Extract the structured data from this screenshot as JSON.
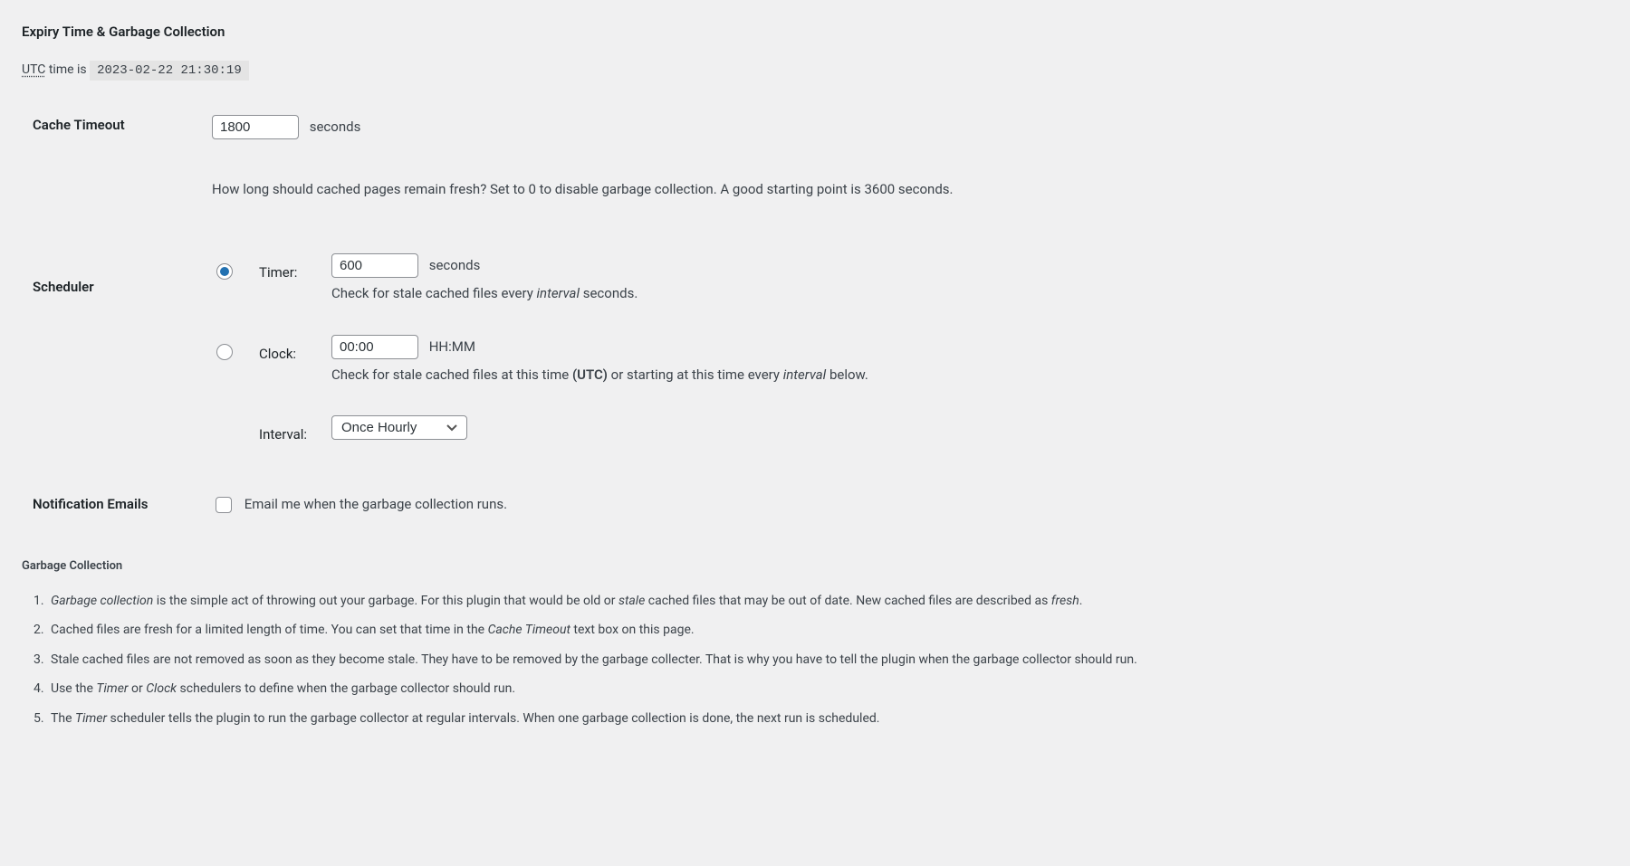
{
  "heading": "Expiry Time & Garbage Collection",
  "utc": {
    "abbr": "UTC",
    "label": " time is ",
    "value": "2023-02-22 21:30:19"
  },
  "cache_timeout": {
    "label": "Cache Timeout",
    "value": "1800",
    "unit": "seconds",
    "description": "How long should cached pages remain fresh? Set to 0 to disable garbage collection. A good starting point is 3600 seconds."
  },
  "scheduler": {
    "label": "Scheduler",
    "timer": {
      "label": "Timer:",
      "value": "600",
      "unit": "seconds",
      "help_pre": "Check for stale cached files every ",
      "help_em": "interval",
      "help_post": " seconds.",
      "checked": true
    },
    "clock": {
      "label": "Clock:",
      "value": "00:00",
      "unit": "HH:MM",
      "help_pre": "Check for stale cached files at this time ",
      "help_bold": "(UTC)",
      "help_mid": " or starting at this time every ",
      "help_em": "interval",
      "help_post": " below.",
      "checked": false
    },
    "interval": {
      "label": "Interval:",
      "selected": "Once Hourly"
    }
  },
  "notification": {
    "label": "Notification Emails",
    "checkbox_label": "Email me when the garbage collection runs.",
    "checked": false
  },
  "gc_heading": "Garbage Collection",
  "gc_items": {
    "i1": {
      "p1": "Garbage collection",
      "p2": " is the simple act of throwing out your garbage. For this plugin that would be old or ",
      "p3": "stale",
      "p4": " cached files that may be out of date. New cached files are described as ",
      "p5": "fresh",
      "p6": "."
    },
    "i2": {
      "p1": "Cached files are fresh for a limited length of time. You can set that time in the ",
      "p2": "Cache Timeout",
      "p3": " text box on this page."
    },
    "i3": {
      "p1": "Stale cached files are not removed as soon as they become stale. They have to be removed by the garbage collecter. That is why you have to tell the plugin when the garbage collector should run."
    },
    "i4": {
      "p1": "Use the ",
      "p2": "Timer",
      "p3": " or ",
      "p4": "Clock",
      "p5": " schedulers to define when the garbage collector should run."
    },
    "i5": {
      "p1": "The ",
      "p2": "Timer",
      "p3": " scheduler tells the plugin to run the garbage collector at regular intervals. When one garbage collection is done, the next run is scheduled."
    }
  }
}
